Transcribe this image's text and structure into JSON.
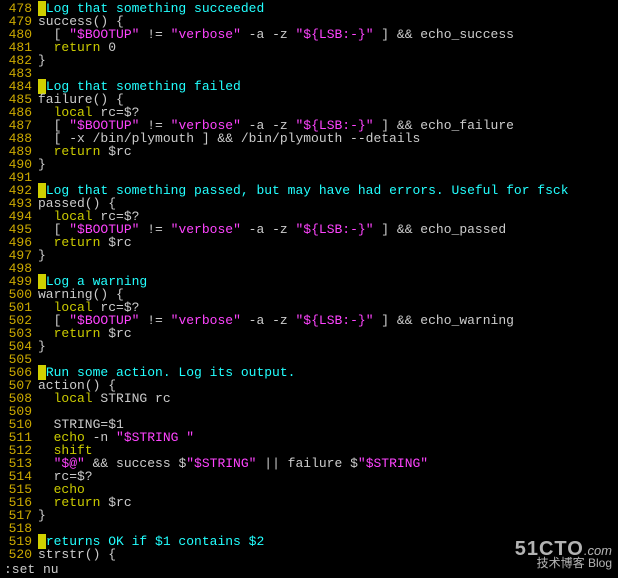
{
  "lines": [
    {
      "n": 478,
      "seg": [
        [
          "block",
          "#"
        ],
        [
          "cyan",
          "Log that something succeeded"
        ]
      ]
    },
    {
      "n": 479,
      "seg": [
        [
          "wht",
          "success() {"
        ]
      ]
    },
    {
      "n": 480,
      "seg": [
        [
          "wht",
          "  [ "
        ],
        [
          "mag",
          "\"$BOOTUP\""
        ],
        [
          "wht",
          " != "
        ],
        [
          "mag",
          "\"verbose\""
        ],
        [
          "wht",
          " -a -z "
        ],
        [
          "mag",
          "\"${LSB:-}\""
        ],
        [
          "wht",
          " ] && echo_success"
        ]
      ]
    },
    {
      "n": 481,
      "seg": [
        [
          "yel",
          "  return"
        ],
        [
          "wht",
          " 0"
        ]
      ]
    },
    {
      "n": 482,
      "seg": [
        [
          "wht",
          "}"
        ]
      ]
    },
    {
      "n": 483,
      "seg": [
        [
          "wht",
          ""
        ]
      ]
    },
    {
      "n": 484,
      "seg": [
        [
          "block",
          "#"
        ],
        [
          "cyan",
          "Log that something failed"
        ]
      ]
    },
    {
      "n": 485,
      "seg": [
        [
          "wht",
          "failure() {"
        ]
      ]
    },
    {
      "n": 486,
      "seg": [
        [
          "yel",
          "  local"
        ],
        [
          "wht",
          " rc=$?"
        ]
      ]
    },
    {
      "n": 487,
      "seg": [
        [
          "wht",
          "  [ "
        ],
        [
          "mag",
          "\"$BOOTUP\""
        ],
        [
          "wht",
          " != "
        ],
        [
          "mag",
          "\"verbose\""
        ],
        [
          "wht",
          " -a -z "
        ],
        [
          "mag",
          "\"${LSB:-}\""
        ],
        [
          "wht",
          " ] && echo_failure"
        ]
      ]
    },
    {
      "n": 488,
      "seg": [
        [
          "wht",
          "  [ -x /bin/plymouth ] && /bin/plymouth --details"
        ]
      ]
    },
    {
      "n": 489,
      "seg": [
        [
          "yel",
          "  return"
        ],
        [
          "wht",
          " $rc"
        ]
      ]
    },
    {
      "n": 490,
      "seg": [
        [
          "wht",
          "}"
        ]
      ]
    },
    {
      "n": 491,
      "seg": [
        [
          "wht",
          ""
        ]
      ]
    },
    {
      "n": 492,
      "seg": [
        [
          "block",
          "#"
        ],
        [
          "cyan",
          "Log that something passed, but may have had errors. Useful for fsck"
        ]
      ]
    },
    {
      "n": 493,
      "seg": [
        [
          "wht",
          "passed() {"
        ]
      ]
    },
    {
      "n": 494,
      "seg": [
        [
          "yel",
          "  local"
        ],
        [
          "wht",
          " rc=$?"
        ]
      ]
    },
    {
      "n": 495,
      "seg": [
        [
          "wht",
          "  [ "
        ],
        [
          "mag",
          "\"$BOOTUP\""
        ],
        [
          "wht",
          " != "
        ],
        [
          "mag",
          "\"verbose\""
        ],
        [
          "wht",
          " -a -z "
        ],
        [
          "mag",
          "\"${LSB:-}\""
        ],
        [
          "wht",
          " ] && echo_passed"
        ]
      ]
    },
    {
      "n": 496,
      "seg": [
        [
          "yel",
          "  return"
        ],
        [
          "wht",
          " $rc"
        ]
      ]
    },
    {
      "n": 497,
      "seg": [
        [
          "wht",
          "}"
        ]
      ]
    },
    {
      "n": 498,
      "seg": [
        [
          "wht",
          ""
        ]
      ]
    },
    {
      "n": 499,
      "seg": [
        [
          "block",
          "#"
        ],
        [
          "cyan",
          "Log a warning"
        ]
      ]
    },
    {
      "n": 500,
      "seg": [
        [
          "wht",
          "warning() {"
        ]
      ]
    },
    {
      "n": 501,
      "seg": [
        [
          "yel",
          "  local"
        ],
        [
          "wht",
          " rc=$?"
        ]
      ]
    },
    {
      "n": 502,
      "seg": [
        [
          "wht",
          "  [ "
        ],
        [
          "mag",
          "\"$BOOTUP\""
        ],
        [
          "wht",
          " != "
        ],
        [
          "mag",
          "\"verbose\""
        ],
        [
          "wht",
          " -a -z "
        ],
        [
          "mag",
          "\"${LSB:-}\""
        ],
        [
          "wht",
          " ] && echo_warning"
        ]
      ]
    },
    {
      "n": 503,
      "seg": [
        [
          "yel",
          "  return"
        ],
        [
          "wht",
          " $rc"
        ]
      ]
    },
    {
      "n": 504,
      "seg": [
        [
          "wht",
          "}"
        ]
      ]
    },
    {
      "n": 505,
      "seg": [
        [
          "wht",
          ""
        ]
      ]
    },
    {
      "n": 506,
      "seg": [
        [
          "block",
          "#"
        ],
        [
          "cyan",
          "Run some action. Log its output."
        ]
      ]
    },
    {
      "n": 507,
      "seg": [
        [
          "wht",
          "action() {"
        ]
      ]
    },
    {
      "n": 508,
      "seg": [
        [
          "yel",
          "  local"
        ],
        [
          "wht",
          " STRING rc"
        ]
      ]
    },
    {
      "n": 509,
      "seg": [
        [
          "wht",
          ""
        ]
      ]
    },
    {
      "n": 510,
      "seg": [
        [
          "wht",
          "  STRING=$1"
        ]
      ]
    },
    {
      "n": 511,
      "seg": [
        [
          "yel",
          "  echo"
        ],
        [
          "wht",
          " -n "
        ],
        [
          "mag",
          "\"$STRING \""
        ]
      ]
    },
    {
      "n": 512,
      "seg": [
        [
          "yel",
          "  shift"
        ]
      ]
    },
    {
      "n": 513,
      "seg": [
        [
          "wht",
          "  "
        ],
        [
          "mag",
          "\"$@\""
        ],
        [
          "wht",
          " && success $"
        ],
        [
          "mag",
          "\"$STRING\""
        ],
        [
          "wht",
          " || failure $"
        ],
        [
          "mag",
          "\"$STRING\""
        ]
      ]
    },
    {
      "n": 514,
      "seg": [
        [
          "wht",
          "  rc=$?"
        ]
      ]
    },
    {
      "n": 515,
      "seg": [
        [
          "yel",
          "  echo"
        ]
      ]
    },
    {
      "n": 516,
      "seg": [
        [
          "yel",
          "  return"
        ],
        [
          "wht",
          " $rc"
        ]
      ]
    },
    {
      "n": 517,
      "seg": [
        [
          "wht",
          "}"
        ]
      ]
    },
    {
      "n": 518,
      "seg": [
        [
          "wht",
          ""
        ]
      ]
    },
    {
      "n": 519,
      "seg": [
        [
          "block",
          "#"
        ],
        [
          "cyan",
          "returns OK if $1 contains $2"
        ]
      ]
    },
    {
      "n": 520,
      "seg": [
        [
          "wht",
          "strstr() {"
        ]
      ]
    }
  ],
  "command": ":set nu",
  "watermark": {
    "site": "51CTO",
    "domain": ".com",
    "tagline": "技术博客   Blog"
  }
}
